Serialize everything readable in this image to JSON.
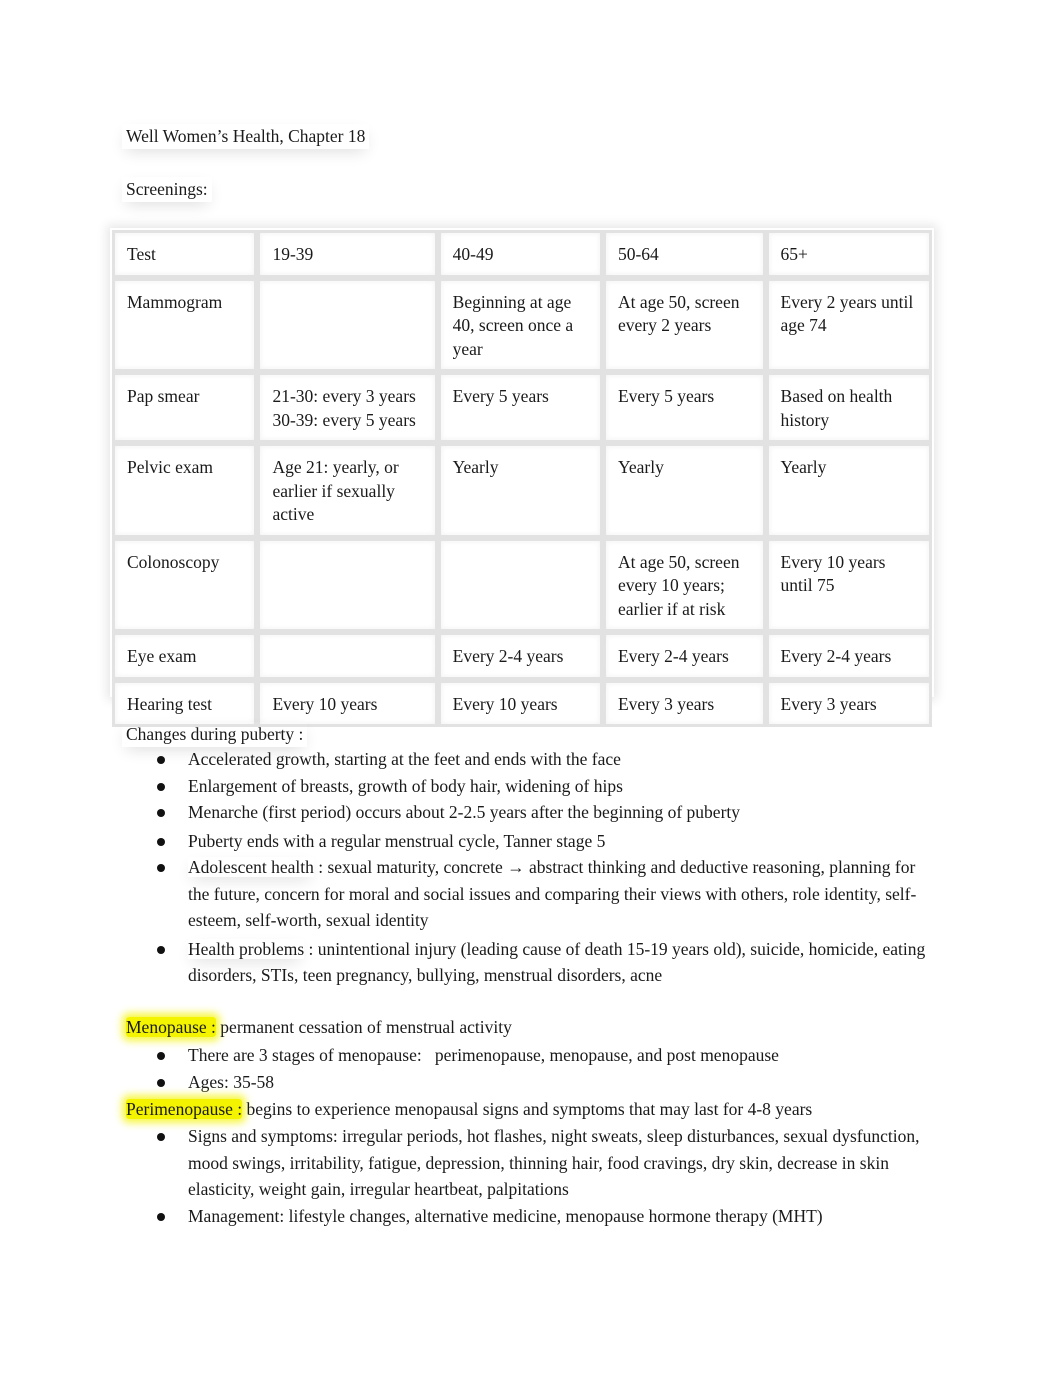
{
  "document": {
    "title": "Well Women’s Health, Chapter 18",
    "screenings_heading": "Screenings:"
  },
  "table": {
    "headers": [
      "Test",
      "19-39",
      "40-49",
      "50-64",
      "65+"
    ],
    "rows": [
      [
        "Mammogram",
        "",
        "Beginning at age 40, screen once a year",
        "At age 50, screen every 2 years",
        "Every 2 years until age 74"
      ],
      [
        "Pap smear",
        "21-30: every 3 years 30-39: every 5 years",
        "Every 5 years",
        "Every 5 years",
        "Based on health history"
      ],
      [
        "Pelvic exam",
        "Age 21: yearly, or earlier if sexually active",
        "Yearly",
        "Yearly",
        "Yearly"
      ],
      [
        "Colonoscopy",
        "",
        "",
        "At age 50, screen every 10 years; earlier if at risk",
        "Every 10 years until 75"
      ],
      [
        "Eye exam",
        "",
        "Every 2-4 years",
        "Every 2-4 years",
        "Every 2-4 years"
      ],
      [
        "Hearing test",
        "Every 10 years",
        "Every 10 years",
        "Every 3 years",
        "Every 3 years"
      ]
    ],
    "pap_19_39_line1": "21-30: every 3 years",
    "pap_19_39_line2": "30-39: every 5 years"
  },
  "puberty": {
    "heading": "Changes during puberty :",
    "items": [
      {
        "text": "Accelerated growth, starting at the feet and ends with the face"
      },
      {
        "text": "Enlargement of breasts, growth of body hair, widening of hips"
      },
      {
        "text": "Menarche (first period) occurs about 2-2.5 years after the beginning of puberty"
      },
      {
        "text": "Puberty ends with a regular menstrual cycle, Tanner stage 5"
      },
      {
        "label": "Adolescent health",
        "text": " : sexual maturity, concrete → abstract thinking and deductive reasoning, planning for the future, concern for moral and social issues and comparing their views with others, role identity, self-esteem, self-worth, sexual identity"
      },
      {
        "label": "Health problems",
        "text": " : unintentional injury (leading cause of death 15-19 years old), suicide, homicide, eating disorders, STIs, teen pregnancy, bullying, menstrual disorders, acne"
      }
    ]
  },
  "menopause": {
    "term": "Menopause :",
    "definition": " permanent cessation of menstrual activity",
    "items": [
      "There are 3 stages of menopause:   perimenopause, menopause, and post menopause",
      "Ages: 35-58"
    ]
  },
  "perimenopause": {
    "term": "Perimenopause :",
    "definition": " begins to experience menopausal signs and symptoms that may last for 4-8 years",
    "items": [
      "Signs and symptoms: irregular periods, hot flashes, night sweats, sleep disturbances, sexual dysfunction, mood swings, irritability, fatigue, depression, thinning hair, food cravings, dry skin, decrease in skin elasticity, weight gain, irregular heartbeat, palpitations",
      "Management: lifestyle changes, alternative medicine, menopause hormone therapy (MHT)"
    ]
  },
  "colors": {
    "highlight": "#f4f400",
    "text": "#1a1a1a",
    "table_border": "#e2e2e2"
  }
}
